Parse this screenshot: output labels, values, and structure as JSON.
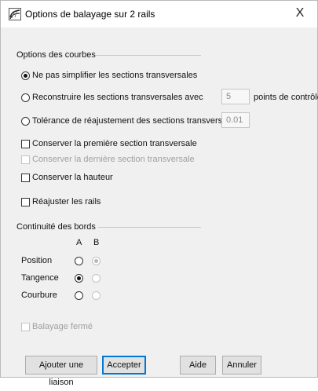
{
  "window": {
    "title": "Options de balayage sur 2 rails",
    "close_glyph": "X",
    "icon": "rhino-sweep-icon"
  },
  "curve_options": {
    "section_label": "Options des courbes",
    "radios": [
      {
        "label": "Ne pas simplifier les sections transversales",
        "checked": true
      },
      {
        "label": "Reconstruire les sections transversales avec",
        "checked": false
      },
      {
        "label": "Tolérance de réajustement des sections transversales",
        "checked": false
      }
    ],
    "rebuild_points_value": "5",
    "rebuild_points_suffix": "points de contrôle",
    "refit_tolerance_value": "0.01",
    "checkboxes": [
      {
        "label": "Conserver la première section transversale",
        "checked": false,
        "enabled": true
      },
      {
        "label": "Conserver la dernière section transversale",
        "checked": false,
        "enabled": false
      },
      {
        "label": "Conserver la hauteur",
        "checked": false,
        "enabled": true
      }
    ],
    "refit_rails_label": "Réajuster les rails",
    "refit_rails_checked": false
  },
  "edge_continuity": {
    "section_label": "Continuité des bords",
    "col_a": "A",
    "col_b": "B",
    "rows": [
      {
        "label": "Position",
        "a_checked": false,
        "b_checked": true
      },
      {
        "label": "Tangence",
        "a_checked": true,
        "b_checked": false
      },
      {
        "label": "Courbure",
        "a_checked": false,
        "b_checked": false
      }
    ]
  },
  "closed_sweep": {
    "label": "Balayage fermé",
    "checked": false,
    "enabled": false
  },
  "buttons": {
    "add_slash": "Ajouter une liaison",
    "accept": "Accepter",
    "help": "Aide",
    "cancel": "Annuler"
  }
}
